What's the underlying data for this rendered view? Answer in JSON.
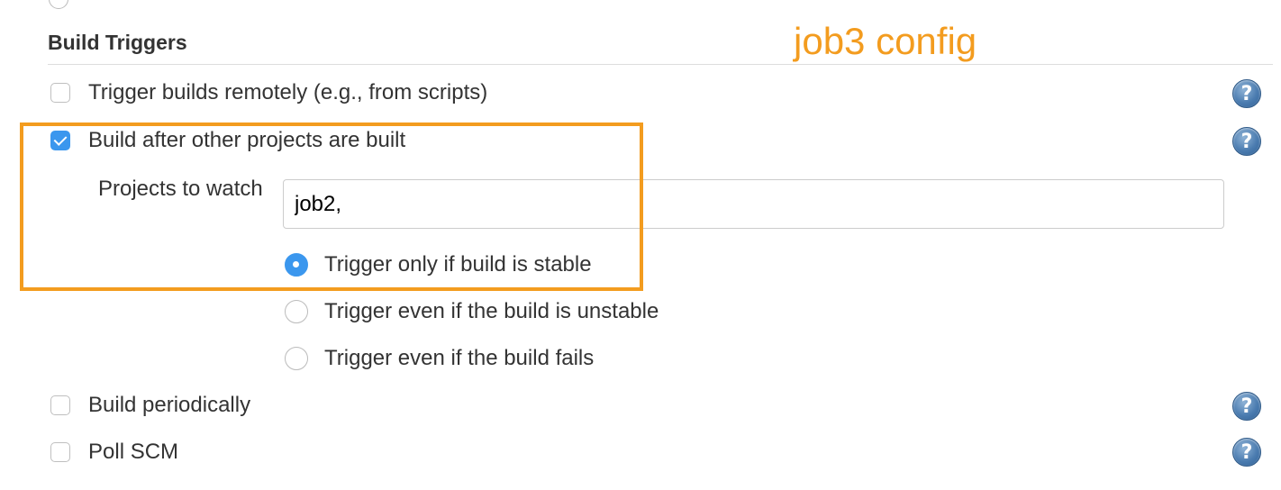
{
  "annotation": {
    "label": "job3 config",
    "color": "#f39c1f"
  },
  "section": {
    "title": "Build Triggers"
  },
  "triggers": {
    "remote": {
      "label": "Trigger builds remotely (e.g., from scripts)",
      "checked": false
    },
    "after_other": {
      "label": "Build after other projects are built",
      "checked": true
    },
    "periodic": {
      "label": "Build periodically",
      "checked": false
    },
    "poll_scm": {
      "label": "Poll SCM",
      "checked": false
    }
  },
  "projects_to_watch": {
    "label": "Projects to watch",
    "value": "job2,"
  },
  "trigger_condition": {
    "selected": "stable",
    "options": [
      {
        "key": "stable",
        "label": "Trigger only if build is stable"
      },
      {
        "key": "unstable",
        "label": "Trigger even if the build is unstable"
      },
      {
        "key": "fails",
        "label": "Trigger even if the build fails"
      }
    ]
  },
  "help": {
    "glyph": "?",
    "icon": "help-icon"
  },
  "colors": {
    "accent": "#3b97ee",
    "help_icon": "#4b7cb0"
  }
}
